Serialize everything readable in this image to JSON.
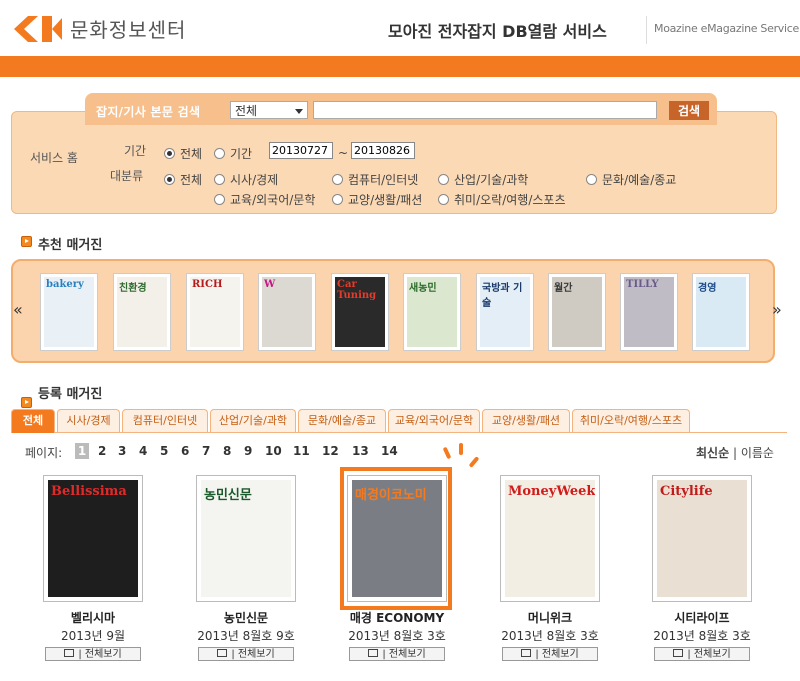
{
  "header": {
    "brand": "문화정보센터",
    "service_title": "모아진 전자잡지 DB열람 서비스",
    "service_en": "Moazine eMagazine Service"
  },
  "search": {
    "label": "잡지/기사 본문 검색",
    "select_value": "전체",
    "query": "",
    "button": "검색",
    "service_home": "서비스 홈",
    "period_label": "기간",
    "period_all": "전체",
    "period_range": "기간",
    "date_from": "20130727",
    "date_sep": "~",
    "date_to": "20130826",
    "category_label": "대분류",
    "categories": [
      "전체",
      "시사/경제",
      "컴퓨터/인터넷",
      "산업/기술/과학",
      "문화/예술/종교",
      "교육/외국어/문학",
      "교양/생활/패션",
      "취미/오락/여행/스포츠"
    ]
  },
  "recommended": {
    "title": "추천 매거진",
    "prev": "«",
    "next": "»",
    "covers": [
      {
        "text": "bakery",
        "bg": "#e9f1f6",
        "fg": "#2a7fbf"
      },
      {
        "text": "친환경",
        "bg": "#f3f0ea",
        "fg": "#2e6a2e"
      },
      {
        "text": "RICH",
        "bg": "#f5f3ee",
        "fg": "#b51a1a"
      },
      {
        "text": "W",
        "bg": "#dcd9d3",
        "fg": "#c71585"
      },
      {
        "text": "Car Tuning",
        "bg": "#2a2a2a",
        "fg": "#e63a2a"
      },
      {
        "text": "새농민",
        "bg": "#dbe8cf",
        "fg": "#2a6a2a"
      },
      {
        "text": "국방과 기술",
        "bg": "#e3eef6",
        "fg": "#1a3a6a"
      },
      {
        "text": "월간",
        "bg": "#cfcac2",
        "fg": "#3a3a3a"
      },
      {
        "text": "TILLY",
        "bg": "#bfbcc6",
        "fg": "#6a5a8a"
      },
      {
        "text": "경영",
        "bg": "#d9eaf5",
        "fg": "#1a4a8a"
      }
    ]
  },
  "registered": {
    "title": "등록 매거진",
    "tabs": [
      "전체",
      "시사/경제",
      "컴퓨터/인터넷",
      "산업/기술/과학",
      "문화/예술/종교",
      "교육/외국어/문학",
      "교양/생활/패션",
      "취미/오락/여행/스포츠"
    ],
    "page_label": "페이지:",
    "pages": [
      "1",
      "2",
      "3",
      "4",
      "5",
      "6",
      "7",
      "8",
      "9",
      "10",
      "11",
      "12",
      "13",
      "14"
    ],
    "sort_latest": "최신순",
    "sort_sep": "|",
    "sort_name": "이름순",
    "view_label": "전체보기",
    "magazines": [
      {
        "name": "벨리시마",
        "issue": "2013년 9월",
        "cover_text": "Bellissima",
        "bg": "#1e1e1e",
        "fg": "#e02a2a"
      },
      {
        "name": "농민신문",
        "issue": "2013년 8월호 9호",
        "cover_text": "농민신문",
        "bg": "#f4f4f0",
        "fg": "#1a5a2a"
      },
      {
        "name": "매경 ECONOMY",
        "issue": "2013년 8월호 3호",
        "cover_text": "매경이코노미",
        "bg": "#7a7e84",
        "fg": "#f47a20"
      },
      {
        "name": "머니위크",
        "issue": "2013년 8월호 3호",
        "cover_text": "MoneyWeek",
        "bg": "#f3eee4",
        "fg": "#d11a1a"
      },
      {
        "name": "시티라이프",
        "issue": "2013년 8월호 3호",
        "cover_text": "Citylife",
        "bg": "#e9dfd2",
        "fg": "#c01a1a"
      }
    ]
  }
}
